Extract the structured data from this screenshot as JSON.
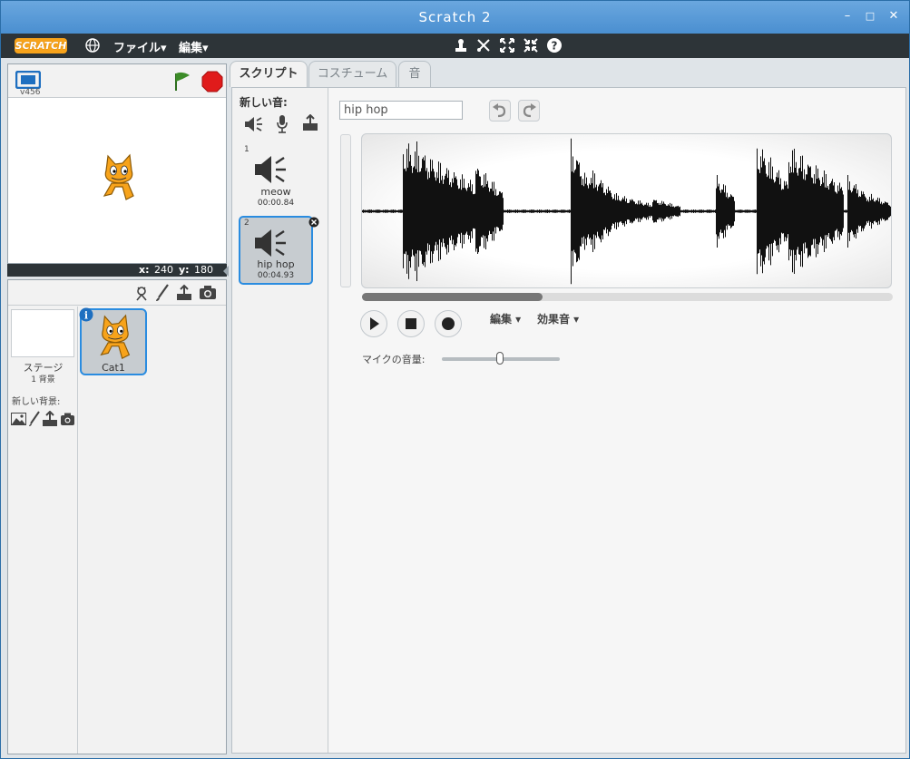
{
  "window": {
    "title": "Scratch 2"
  },
  "menubar": {
    "logo": "SCRATCH",
    "file": "ファイル▾",
    "edit": "編集▾"
  },
  "stage": {
    "version": "v456",
    "x_label": "x:",
    "x_value": "240",
    "y_label": "y:",
    "y_value": "180"
  },
  "sprites": {
    "stage_label": "ステージ",
    "stage_backdrops": "1 背景",
    "new_backdrop_label": "新しい背景:",
    "cat_name": "Cat1"
  },
  "tabs": {
    "scripts": "スクリプト",
    "costumes": "コスチューム",
    "sounds": "音"
  },
  "sound_list": {
    "new_sound_label": "新しい音:",
    "items": [
      {
        "index": "1",
        "name": "meow",
        "duration": "00:00.84"
      },
      {
        "index": "2",
        "name": "hip hop",
        "duration": "00:04.93"
      }
    ]
  },
  "sound_editor": {
    "name_value": "hip hop",
    "edit_menu": "編集 ▾",
    "effects_menu": "効果音 ▾",
    "mic_volume_label": "マイクの音量:",
    "mic_volume_level": 0.49,
    "scroll_position": 0.34
  },
  "colors": {
    "accent": "#4a8fd0",
    "menubar": "#2d3438",
    "selected": "#2a8ce0",
    "logo": "#f7a31b"
  }
}
